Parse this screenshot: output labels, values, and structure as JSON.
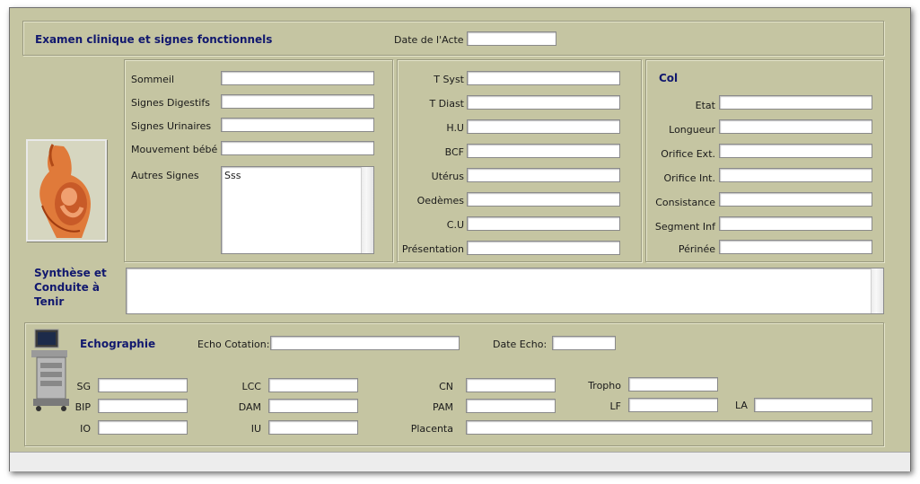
{
  "header": {
    "title": "Examen clinique et signes fonctionnels",
    "date_label": "Date de l'Acte",
    "date_value": ""
  },
  "signes": {
    "sommeil": {
      "label": "Sommeil",
      "value": ""
    },
    "digestifs": {
      "label": "Signes Digestifs",
      "value": ""
    },
    "urinaires": {
      "label": "Signes Urinaires",
      "value": ""
    },
    "mouvement": {
      "label": "Mouvement bébé",
      "value": ""
    },
    "autres": {
      "label": "Autres Signes",
      "value": "Sss"
    }
  },
  "vitals": {
    "t_syst": {
      "label": "T Syst",
      "value": ""
    },
    "t_diast": {
      "label": "T Diast",
      "value": ""
    },
    "hu": {
      "label": "H.U",
      "value": ""
    },
    "bcf": {
      "label": "BCF",
      "value": ""
    },
    "uterus": {
      "label": "Utérus",
      "value": ""
    },
    "oedemes": {
      "label": "Oedèmes",
      "value": ""
    },
    "cu": {
      "label": "C.U",
      "value": ""
    },
    "presentation": {
      "label": "Présentation",
      "value": ""
    }
  },
  "col": {
    "title": "Col",
    "etat": {
      "label": "Etat",
      "value": ""
    },
    "longueur": {
      "label": "Longueur",
      "value": ""
    },
    "orifice_ext": {
      "label": "Orifice Ext.",
      "value": ""
    },
    "orifice_int": {
      "label": "Orifice Int.",
      "value": ""
    },
    "consistance": {
      "label": "Consistance",
      "value": ""
    },
    "segment_inf": {
      "label": "Segment Inf",
      "value": ""
    },
    "perinee": {
      "label": "Périnée",
      "value": ""
    }
  },
  "synthese": {
    "line1": "Synthèse et",
    "line2": "Conduite à",
    "line3": "Tenir",
    "value": ""
  },
  "echo": {
    "title": "Echographie",
    "cotation_label": "Echo Cotation:",
    "cotation_value": "",
    "date_label": "Date Echo:",
    "date_value": "",
    "sg": {
      "label": "SG",
      "value": ""
    },
    "bip": {
      "label": "BIP",
      "value": ""
    },
    "io": {
      "label": "IO",
      "value": ""
    },
    "lcc": {
      "label": "LCC",
      "value": ""
    },
    "dam": {
      "label": "DAM",
      "value": ""
    },
    "iu": {
      "label": "IU",
      "value": ""
    },
    "cn": {
      "label": "CN",
      "value": ""
    },
    "pam": {
      "label": "PAM",
      "value": ""
    },
    "placenta": {
      "label": "Placenta",
      "value": ""
    },
    "tropho": {
      "label": "Tropho",
      "value": ""
    },
    "lf": {
      "label": "LF",
      "value": ""
    },
    "la": {
      "label": "LA",
      "value": ""
    }
  },
  "icons": {
    "pregnancy": "pregnancy-illustration-icon",
    "ultrasound": "ultrasound-machine-icon"
  }
}
